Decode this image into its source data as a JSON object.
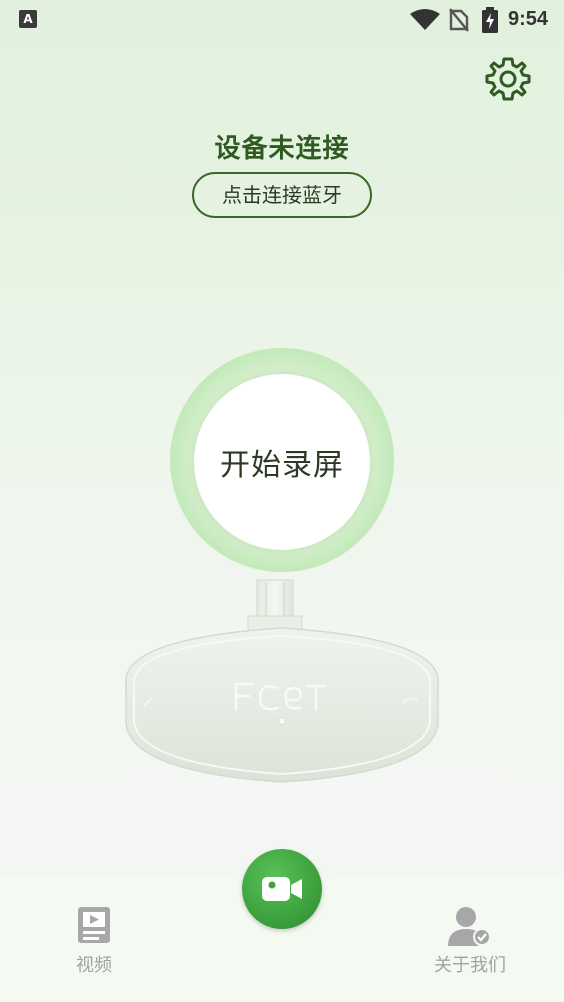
{
  "status_bar": {
    "keyboard_indicator": "A",
    "time": "9:54",
    "icons": [
      "wifi-icon",
      "no-sim-icon",
      "battery-charging-icon"
    ]
  },
  "header": {
    "settings_icon": "gear-icon",
    "device_status": "设备未连接",
    "connect_button": "点击连接蓝牙"
  },
  "main": {
    "record_button": "开始录屏",
    "device_logo": "FCET"
  },
  "bottom_nav": {
    "items": [
      {
        "label": "视频",
        "icon": "video-list-icon"
      },
      {
        "label": "关于我们",
        "icon": "user-check-icon"
      }
    ],
    "center_button_icon": "video-camera-icon"
  },
  "colors": {
    "accent_green": "#3fa43f",
    "title_green": "#2f5a22",
    "nav_gray": "#a2a2a2"
  }
}
